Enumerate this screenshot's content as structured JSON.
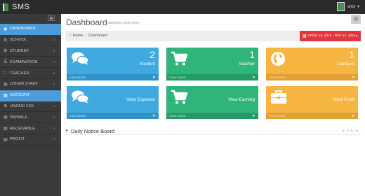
{
  "app": {
    "title": "SMS"
  },
  "user": {
    "name": "sms"
  },
  "sidebar": {
    "items": [
      {
        "label": "DASHBOARD",
        "icon": "dashboard-icon",
        "active": true
      },
      {
        "label": "SCHOOL",
        "icon": "school-icon"
      },
      {
        "label": "STUDENT",
        "icon": "student-icon"
      },
      {
        "label": "EXAMINATION",
        "icon": "examination-icon"
      },
      {
        "label": "TEACHER",
        "icon": "teacher-icon"
      },
      {
        "label": "OTHER STAFF",
        "icon": "staff-icon"
      },
      {
        "label": "ACCOUNT",
        "icon": "account-icon",
        "active": true
      },
      {
        "label": "UNPAID FEE",
        "icon": "unpaid-fee-icon"
      },
      {
        "label": "PAYABLE",
        "icon": "payable-icon"
      },
      {
        "label": "RECEIVABLE",
        "icon": "receivable-icon"
      },
      {
        "label": "PROFIT",
        "icon": "profit-icon"
      }
    ]
  },
  "header": {
    "title": "Dashboard",
    "subtitle": "statistics and more"
  },
  "breadcrumb": {
    "home": "Home",
    "current": "Dashboard"
  },
  "date_range": {
    "label": "APRIL 13, 2016 - MAY 12, 2016"
  },
  "tiles": [
    {
      "number": "2",
      "label": "Student",
      "footer": "VIEW MORE",
      "color": "#3fa9e0",
      "icon": "comments-icon"
    },
    {
      "number": "1",
      "label": "Teacher",
      "footer": "VIEW MORE",
      "color": "#2fb57a",
      "icon": "cart-icon"
    },
    {
      "number": "1",
      "label": "Campus",
      "footer": "VIEW MORE",
      "color": "#f6b541",
      "icon": "globe-icon"
    },
    {
      "number": "",
      "label": "View Expense",
      "footer": "VIEW MORE",
      "color": "#3fa9e0",
      "icon": "comments-icon"
    },
    {
      "number": "",
      "label": "View Earning",
      "footer": "VIEW MORE",
      "color": "#2fb57a",
      "icon": "cart-icon"
    },
    {
      "number": "",
      "label": "View Profit",
      "footer": "VIEW MORE",
      "color": "#f6b541",
      "icon": "briefcase-icon"
    }
  ],
  "notice": {
    "title": "Daily Notice Board"
  },
  "colors": {
    "accent": "#4e9bdc",
    "danger": "#e5353f",
    "topbar": "#2b2b2b",
    "sidebar": "#3a3a3a"
  }
}
